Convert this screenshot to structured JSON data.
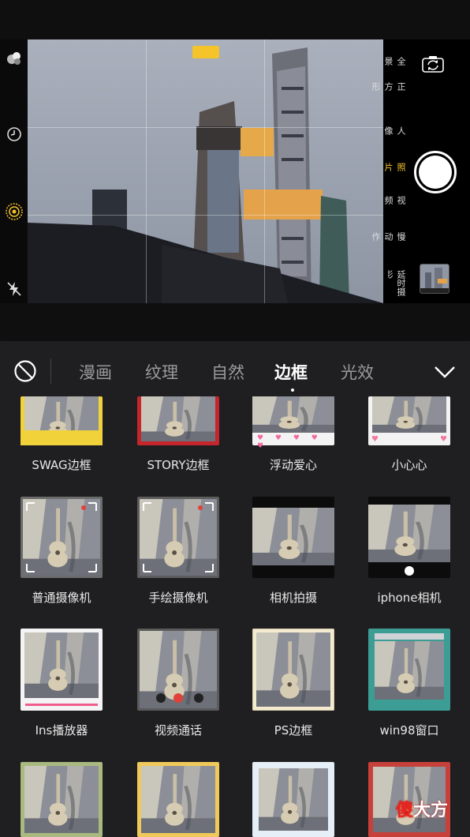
{
  "camera": {
    "mode_badge": "",
    "modes": [
      {
        "label": "全景",
        "active": false
      },
      {
        "label": "正方形",
        "active": false
      },
      {
        "label": "人像",
        "active": false
      },
      {
        "label": "照片",
        "active": true
      },
      {
        "label": "视频",
        "active": false
      },
      {
        "label": "慢动作",
        "active": false
      },
      {
        "label": "延时摄影",
        "active": false
      }
    ],
    "accent_color": "#f5c42a"
  },
  "filters": {
    "tabs": [
      {
        "label": "漫画",
        "active": false
      },
      {
        "label": "纹理",
        "active": false
      },
      {
        "label": "自然",
        "active": false
      },
      {
        "label": "边框",
        "active": true
      },
      {
        "label": "光效",
        "active": false
      }
    ],
    "items": [
      {
        "label": "SWAG边框"
      },
      {
        "label": "STORY边框"
      },
      {
        "label": "浮动爱心"
      },
      {
        "label": "小心心"
      },
      {
        "label": "普通摄像机"
      },
      {
        "label": "手绘摄像机"
      },
      {
        "label": "相机拍摄"
      },
      {
        "label": "iphone相机"
      },
      {
        "label": "Ins播放器"
      },
      {
        "label": "视频通话"
      },
      {
        "label": "PS边框"
      },
      {
        "label": "win98窗口"
      },
      {
        "label": ""
      },
      {
        "label": ""
      },
      {
        "label": ""
      },
      {
        "label": ""
      }
    ]
  },
  "watermark": {
    "part1": "傻",
    "part2": "大方"
  }
}
